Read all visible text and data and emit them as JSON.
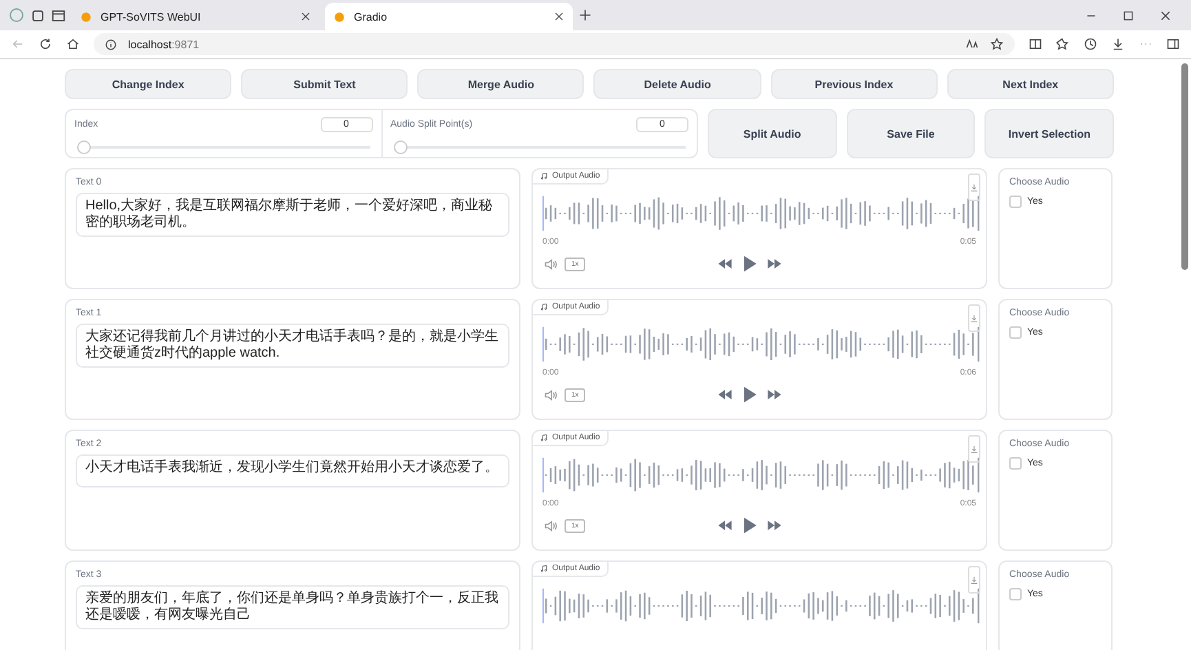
{
  "browser": {
    "tabs": [
      {
        "title": "GPT-SoVITS WebUI",
        "selected": false
      },
      {
        "title": "Gradio",
        "selected": true
      }
    ],
    "address": {
      "host": "localhost",
      "port": ":9871"
    }
  },
  "buttons": [
    "Change Index",
    "Submit Text",
    "Merge Audio",
    "Delete Audio",
    "Previous Index",
    "Next Index"
  ],
  "sliders": [
    {
      "label": "Index",
      "value": "0",
      "level": 0
    },
    {
      "label": "Audio Split Point(s)",
      "value": "0",
      "level": 0
    }
  ],
  "actions": [
    "Split Audio",
    "Save File",
    "Invert Selection"
  ],
  "rows": [
    {
      "text_label": "Text 0",
      "text": "Hello,大家好，我是互联网福尔摩斯于老师，一个爱好深吧，商业秘密的职场老司机。",
      "audio": {
        "label": "Output Audio",
        "start": "0:00",
        "end": "0:05",
        "speed": "1x"
      },
      "choose": {
        "label": "Choose Audio",
        "option": "Yes",
        "checked": false
      }
    },
    {
      "text_label": "Text 1",
      "text": "大家还记得我前几个月讲过的小天才电话手表吗？是的，就是小学生社交硬通货z时代的apple watch.",
      "audio": {
        "label": "Output Audio",
        "start": "0:00",
        "end": "0:06",
        "speed": "1x"
      },
      "choose": {
        "label": "Choose Audio",
        "option": "Yes",
        "checked": false
      }
    },
    {
      "text_label": "Text 2",
      "text": "小天才电话手表我渐近，发现小学生们竟然开始用小天才谈恋爱了。",
      "audio": {
        "label": "Output Audio",
        "start": "0:00",
        "end": "0:05",
        "speed": "1x"
      },
      "choose": {
        "label": "Choose Audio",
        "option": "Yes",
        "checked": false
      }
    },
    {
      "text_label": "Text 3",
      "text": "亲爱的朋友们，年底了，你们还是单身吗？单身贵族打个一，反正我还是嗳嗳，有网友曝光自己",
      "audio": {
        "label": "Output Audio"
      },
      "choose": {
        "label": "Choose Audio",
        "option": "Yes",
        "checked": false
      }
    }
  ]
}
